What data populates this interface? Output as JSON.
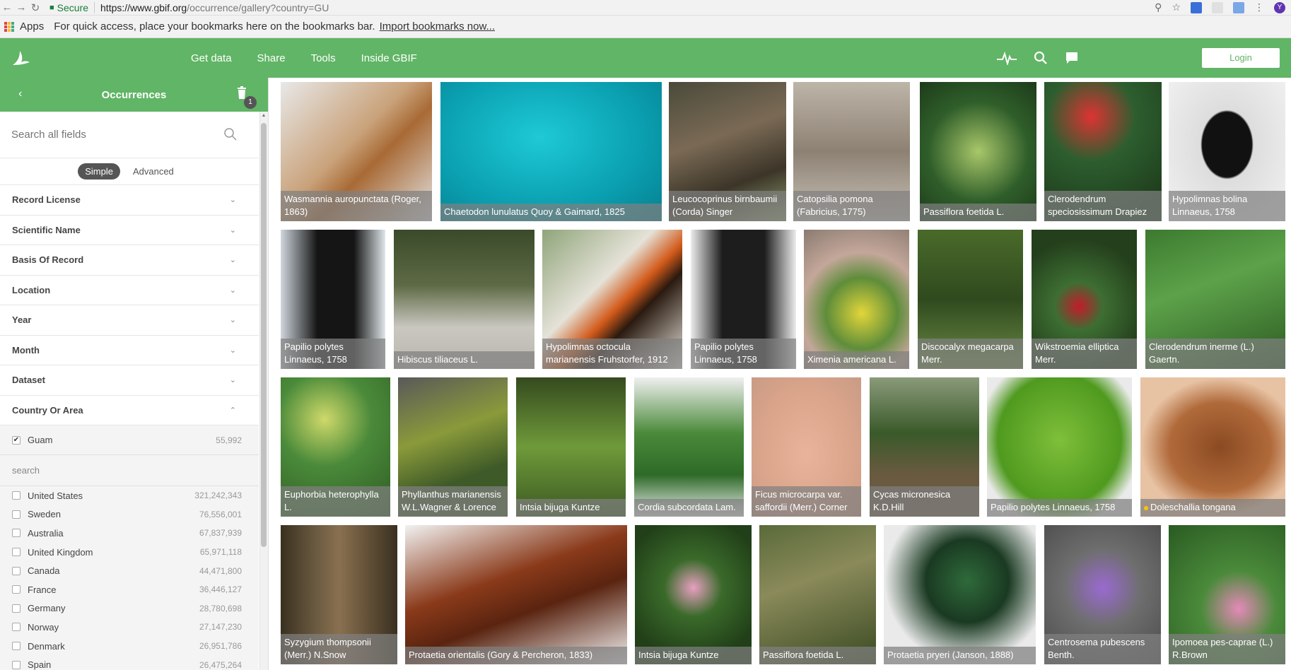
{
  "browser": {
    "secure_label": "Secure",
    "url_host": "https://www.gbif.org",
    "url_path": "/occurrence/gallery?country=GU",
    "profile_initial": "Y"
  },
  "bookmarks": {
    "apps_label": "Apps",
    "hint_text": "For quick access, place your bookmarks here on the bookmarks bar.",
    "import_link": "Import bookmarks now..."
  },
  "topnav": {
    "links": [
      "Get data",
      "Share",
      "Tools",
      "Inside GBIF"
    ],
    "login_label": "Login"
  },
  "sidebar": {
    "title": "Occurrences",
    "filter_count": "1",
    "search_placeholder": "Search all fields",
    "mode_simple": "Simple",
    "mode_advanced": "Advanced",
    "filters": [
      "Record License",
      "Scientific Name",
      "Basis Of Record",
      "Location",
      "Year",
      "Month",
      "Dataset",
      "Country Or Area"
    ],
    "selected_country": {
      "name": "Guam",
      "count": "55,992"
    },
    "country_search_placeholder": "search",
    "countries": [
      {
        "name": "United States",
        "count": "321,242,343"
      },
      {
        "name": "Sweden",
        "count": "76,556,001"
      },
      {
        "name": "Australia",
        "count": "67,837,939"
      },
      {
        "name": "United Kingdom",
        "count": "65,971,118"
      },
      {
        "name": "Canada",
        "count": "44,471,800"
      },
      {
        "name": "France",
        "count": "36,446,127"
      },
      {
        "name": "Germany",
        "count": "28,780,698"
      },
      {
        "name": "Norway",
        "count": "27,147,230"
      },
      {
        "name": "Denmark",
        "count": "26,951,786"
      },
      {
        "name": "Spain",
        "count": "26,475,264"
      }
    ]
  },
  "gallery": {
    "captions": [
      "Wasmannia auropunctata (Roger, 1863)",
      "Chaetodon lunulatus Quoy & Gaimard, 1825",
      "Leucocoprinus birnbaumii (Corda) Singer",
      "Catopsilia pomona (Fabricius, 1775)",
      "Passiflora foetida L.",
      "Clerodendrum speciosissimum Drapiez",
      "Hypolimnas bolina Linnaeus, 1758",
      "Papilio polytes Linnaeus, 1758",
      "Hibiscus tiliaceus L.",
      "Hypolimnas octocula marianensis Fruhstorfer, 1912",
      "Papilio polytes Linnaeus, 1758",
      "Ximenia americana L.",
      "Discocalyx megacarpa Merr.",
      "Wikstroemia elliptica Merr.",
      "Clerodendrum inerme (L.) Gaertn.",
      "Euphorbia heterophylla L.",
      "Phyllanthus marianensis W.L.Wagner & Lorence",
      "Intsia bijuga Kuntze",
      "Cordia subcordata Lam.",
      "Ficus microcarpa var. saffordii (Merr.) Corner",
      "Cycas micronesica K.D.Hill",
      "Papilio polytes Linnaeus, 1758",
      "Doleschallia tongana",
      "Syzygium thompsonii (Merr.) N.Snow",
      "Protaetia orientalis (Gory & Percheron, 1833)",
      "Intsia bijuga Kuntze",
      "Passiflora foetida L.",
      "Protaetia pryeri (Janson, 1888)",
      "Centrosema pubescens Benth.",
      "Ipomoea pes-caprae (L.) R.Brown"
    ]
  }
}
